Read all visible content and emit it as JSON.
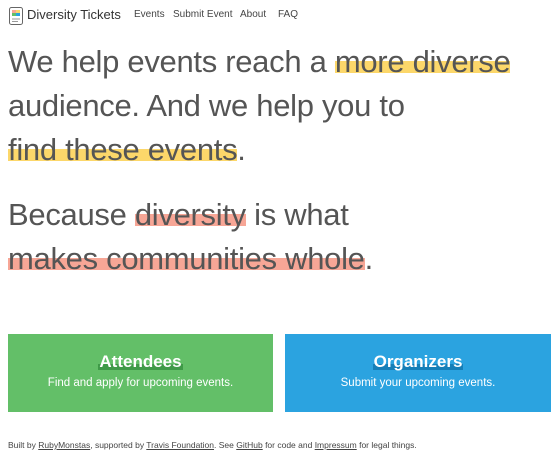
{
  "nav": {
    "brand": "Diversity Tickets",
    "links": [
      "Events",
      "Submit Event",
      "About",
      "FAQ"
    ]
  },
  "hero": {
    "line1_pre": "We help events reach a ",
    "line1_hl": "more diverse",
    "line2": "audience. And we help you to",
    "line3_hl": "find these events",
    "line3_post": ".",
    "line4_pre": "Because ",
    "line4_hl": "diversity",
    "line4_post": " is what",
    "line5_hl": "makes communities whole",
    "line5_post": "."
  },
  "cards": {
    "attendees": {
      "title": "Attendees",
      "subtitle": "Find and apply for upcoming events."
    },
    "organizers": {
      "title": "Organizers",
      "subtitle": "Submit your upcoming events."
    }
  },
  "footer": {
    "t1": "Built by ",
    "link1": "RubyMonstas",
    "t2": ", supported by ",
    "link2": "Travis Foundation",
    "t3": ". See ",
    "link3": "GitHub",
    "t4": " for code and ",
    "link4": "Impressum",
    "t5": " for legal things."
  },
  "colors": {
    "highlight_yellow": "#fcd76a",
    "highlight_red": "#f7a696",
    "attendees_card": "#63bf68",
    "organizers_card": "#2ba3e0"
  }
}
